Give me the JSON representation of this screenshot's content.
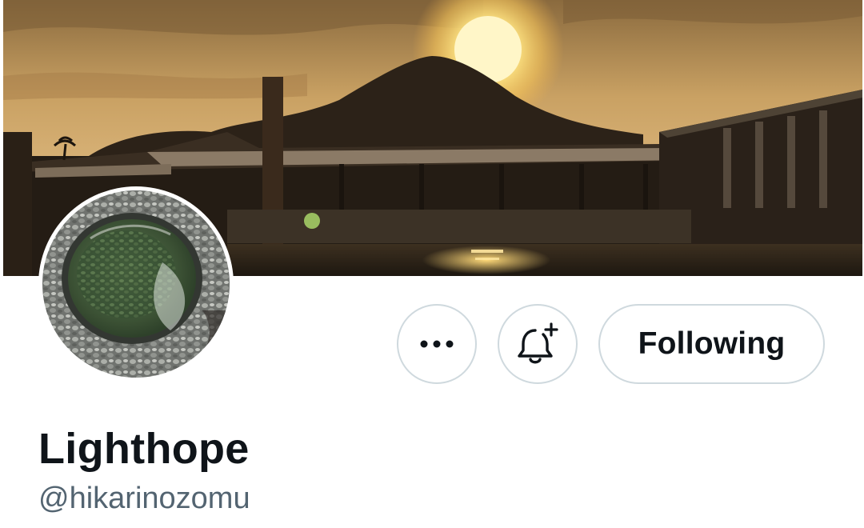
{
  "profile": {
    "display_name": "Lighthope",
    "handle": "@hikarinozomu",
    "banner_image": "sunset-mountain-harbor-banner",
    "avatar_image": "stone-well-water-avatar"
  },
  "actions": {
    "more_icon": "more-horizontal-icon",
    "notify_icon": "bell-plus-icon",
    "following_label": "Following"
  },
  "colors": {
    "text_primary": "#0f1419",
    "text_secondary": "#536471",
    "border": "#cfd9de",
    "background": "#ffffff"
  }
}
